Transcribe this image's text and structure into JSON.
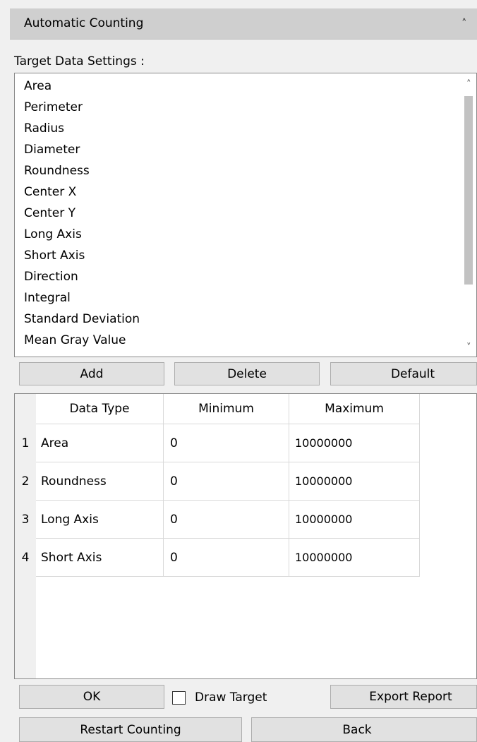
{
  "panel": {
    "title": "Automatic Counting",
    "collapse_icon": "chevron-up-icon"
  },
  "target_settings": {
    "label": "Target Data Settings :",
    "items": [
      "Area",
      "Perimeter",
      "Radius",
      "Diameter",
      "Roundness",
      "Center X",
      "Center Y",
      "Long Axis",
      "Short Axis",
      "Direction",
      "Integral",
      "Standard Deviation",
      "Mean Gray Value"
    ]
  },
  "list_buttons": {
    "add": "Add",
    "delete": "Delete",
    "default": "Default"
  },
  "table": {
    "headers": [
      "Data Type",
      "Minimum",
      "Maximum"
    ],
    "rows": [
      {
        "num": "1",
        "type": "Area",
        "min": "0",
        "max": "10000000"
      },
      {
        "num": "2",
        "type": "Roundness",
        "min": "0",
        "max": "10000000"
      },
      {
        "num": "3",
        "type": "Long Axis",
        "min": "0",
        "max": "10000000"
      },
      {
        "num": "4",
        "type": "Short Axis",
        "min": "0",
        "max": "10000000"
      }
    ]
  },
  "footer": {
    "ok": "OK",
    "draw_target": "Draw Target",
    "draw_target_checked": false,
    "export_report": "Export Report",
    "restart_counting": "Restart Counting",
    "back": "Back"
  }
}
